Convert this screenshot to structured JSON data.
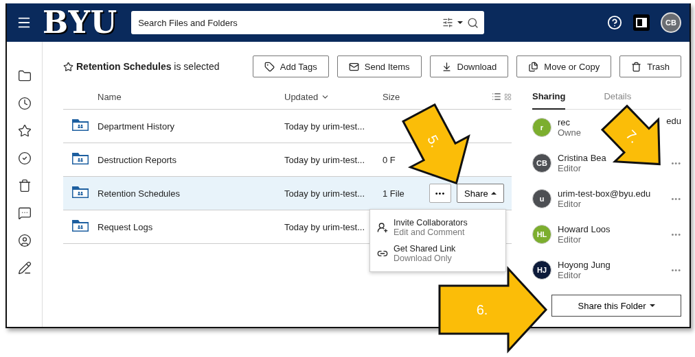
{
  "header": {
    "logo": "BYU",
    "search": {
      "placeholder": "Search Files and Folders"
    },
    "avatar": "CB"
  },
  "sidebar": {
    "items": [
      {
        "kind": "folder"
      },
      {
        "kind": "recent"
      },
      {
        "kind": "favorites"
      },
      {
        "kind": "tasks"
      },
      {
        "kind": "trash"
      },
      {
        "kind": "messages"
      },
      {
        "kind": "profile"
      },
      {
        "kind": "notes"
      }
    ]
  },
  "selection": {
    "name": "Retention Schedules",
    "suffix": "is selected"
  },
  "toolbar": [
    {
      "kind": "tag",
      "label": "Add Tags"
    },
    {
      "kind": "mail",
      "label": "Send Items"
    },
    {
      "kind": "download",
      "label": "Download"
    },
    {
      "kind": "copy",
      "label": "Move or Copy"
    },
    {
      "kind": "trash",
      "label": "Trash"
    }
  ],
  "table": {
    "columns": [
      {
        "label": "Name"
      },
      {
        "label": "Updated"
      },
      {
        "label": "Size"
      }
    ],
    "rows": [
      {
        "name": "Department History",
        "updated": "Today by urim-test...",
        "size": "",
        "selected": false
      },
      {
        "name": "Destruction Reports",
        "updated": "Today by urim-test...",
        "size": "0 F",
        "selected": false
      },
      {
        "name": "Retention Schedules",
        "updated": "Today by urim-test...",
        "size": "1 File",
        "selected": true,
        "more": "•••",
        "share": "Share"
      },
      {
        "name": "Request Logs",
        "updated": "Today by urim-test...",
        "size": "",
        "selected": false
      }
    ]
  },
  "share_menu": [
    {
      "kind": "invite",
      "title": "Invite Collaborators",
      "subtitle": "Edit and Comment"
    },
    {
      "kind": "link",
      "title": "Get Shared Link",
      "subtitle": "Download Only"
    }
  ],
  "panel": {
    "tabs": [
      {
        "label": "Sharing",
        "selected": true
      },
      {
        "label": "Details",
        "selected": false
      }
    ],
    "collaborators": [
      {
        "initials": "r",
        "color": "#7cae2e",
        "name": "rec",
        "name_end": "edu",
        "role": "Owne"
      },
      {
        "initials": "CB",
        "color": "#4d4f53",
        "name": "Cristina Bea",
        "role": "Editor",
        "more": "•••"
      },
      {
        "initials": "u",
        "color": "#4d4f53",
        "name": "urim-test-box@byu.edu",
        "role": "Editor",
        "more": "•••"
      },
      {
        "initials": "HL",
        "color": "#7cae2e",
        "name": "Howard Loos",
        "role": "Editor",
        "more": "•••"
      },
      {
        "initials": "HJ",
        "color": "#0d1b3a",
        "name": "Hoyong Jung",
        "role": "Editor",
        "more": "•••"
      }
    ],
    "share_button": "Share this Folder"
  },
  "annotations": [
    {
      "label": "5."
    },
    {
      "label": "6."
    },
    {
      "label": "7."
    }
  ]
}
